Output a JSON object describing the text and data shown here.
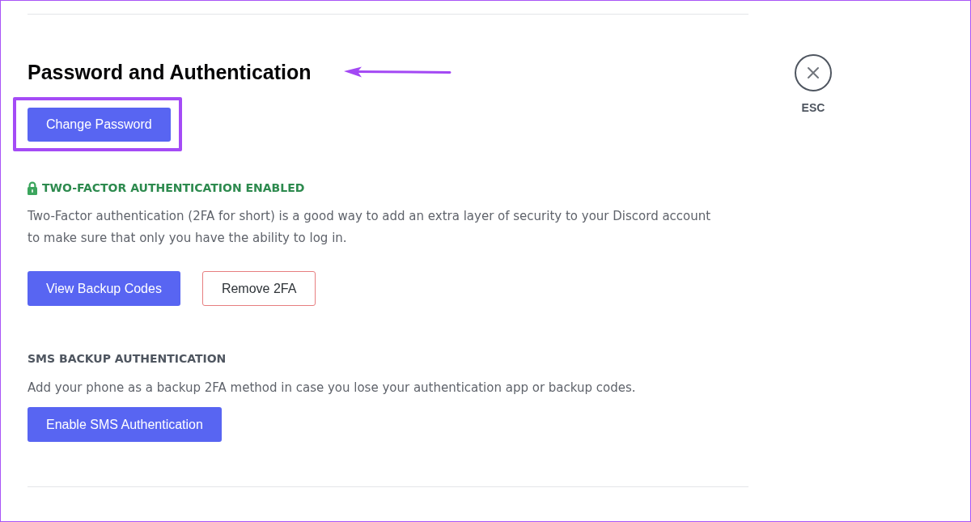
{
  "password": {
    "title": "Password and Authentication",
    "title_annotated": true,
    "button": {
      "label": "Change Password",
      "highlighted": true
    }
  },
  "two_factor": {
    "status": "TWO-FACTOR AUTHENTICATION ENABLED",
    "enabled": true,
    "description": "Two-Factor authentication (2FA for short) is a good way to add an extra layer of security to your Discord account to make sure that only you have the ability to log in.",
    "buttons": [
      {
        "label": "View Backup Codes",
        "kind": "primary"
      },
      {
        "label": "Remove 2FA",
        "kind": "danger-outline"
      }
    ]
  },
  "sms_backup": {
    "title": "SMS BACKUP AUTHENTICATION",
    "description": "Add your phone as a backup 2FA method in case you lose your authentication app or backup codes.",
    "buttons": [
      {
        "label": "Enable SMS Authentication",
        "kind": "primary"
      }
    ]
  },
  "close": {
    "label": "ESC"
  }
}
